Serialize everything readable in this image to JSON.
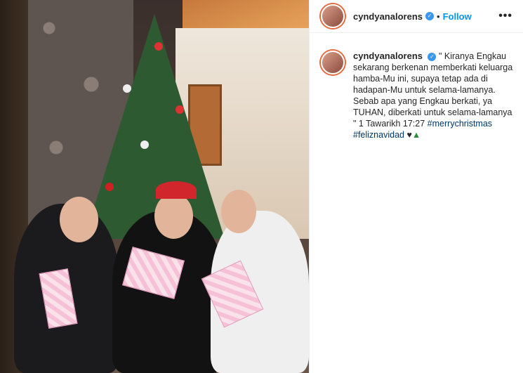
{
  "post": {
    "username": "cyndyanalorens",
    "separator": "•",
    "follow_label": "Follow",
    "more_label": "•••",
    "caption_text": "\" Kiranya Engkau sekarang berkenan memberkati keluarga hamba-Mu ini, supaya tetap ada di hadapan-Mu untuk selama-lamanya. Sebab apa yang Engkau berkati, ya TUHAN, diberkati untuk selama-lamanya \" 1 Tawarikh 17:27",
    "hashtag_1": "#merrychristmas",
    "hashtag_2": "#feliznavidad",
    "emoji_tail": "♥",
    "tree_emoji": "▲",
    "verified_glyph": "✓"
  },
  "colors": {
    "accent": "#0095f6",
    "verified": "#3897f0",
    "hashtag": "#00376b"
  },
  "icons": [
    "verified-badge-icon",
    "more-options-icon",
    "christmas-tree-emoji"
  ]
}
